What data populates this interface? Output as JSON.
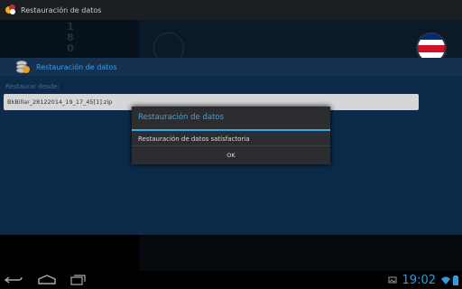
{
  "titlebar": {
    "title": "Restauración de datos"
  },
  "header": {
    "digits": "1\n8\n0"
  },
  "section": {
    "label": "Restauración de datos"
  },
  "content": {
    "field_label": "Restaurar desde:",
    "file_name": "BkBillar_28122014_19_17_45[1].zip"
  },
  "dialog": {
    "title": "Restauración de datos",
    "message": "Restauración de datos satisfactoria",
    "ok_label": "OK"
  },
  "statusbar": {
    "time": "19:02"
  },
  "colors": {
    "accent": "#35a8e6",
    "content_bg": "#0c2b4a",
    "section_bg": "#163150"
  },
  "icons": [
    "back-icon",
    "home-icon",
    "recent-apps-icon",
    "gallery-icon",
    "wifi-icon",
    "battery-icon",
    "costa-rica-flag-icon",
    "database-restore-icon"
  ]
}
